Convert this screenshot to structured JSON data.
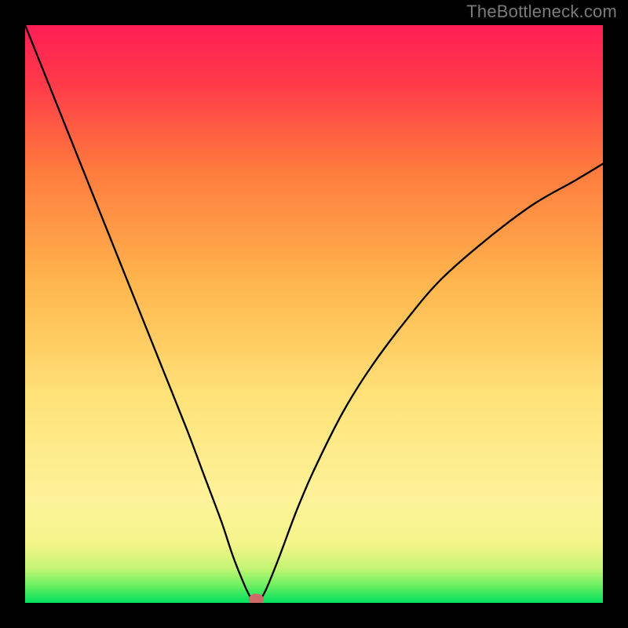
{
  "watermark": "TheBottleneck.com",
  "chart_data": {
    "type": "line",
    "title": "",
    "xlabel": "",
    "ylabel": "",
    "xlim": [
      0,
      100
    ],
    "ylim": [
      0,
      100
    ],
    "gradient_stops": [
      {
        "offset": 0.0,
        "color": "#00e05e"
      },
      {
        "offset": 0.03,
        "color": "#6bf060"
      },
      {
        "offset": 0.06,
        "color": "#c4f574"
      },
      {
        "offset": 0.1,
        "color": "#f3f58a"
      },
      {
        "offset": 0.18,
        "color": "#fef29a"
      },
      {
        "offset": 0.35,
        "color": "#ffe37a"
      },
      {
        "offset": 0.55,
        "color": "#ffb74e"
      },
      {
        "offset": 0.75,
        "color": "#ff7a3e"
      },
      {
        "offset": 0.9,
        "color": "#ff3a4a"
      },
      {
        "offset": 1.0,
        "color": "#ff1e56"
      }
    ],
    "curve": {
      "minimum_x": 40,
      "left_branch": [
        {
          "x": 0,
          "y": 100
        },
        {
          "x": 4,
          "y": 90
        },
        {
          "x": 8,
          "y": 80
        },
        {
          "x": 12,
          "y": 70
        },
        {
          "x": 16,
          "y": 60
        },
        {
          "x": 20,
          "y": 50
        },
        {
          "x": 24,
          "y": 40
        },
        {
          "x": 28,
          "y": 30
        },
        {
          "x": 31,
          "y": 22
        },
        {
          "x": 34,
          "y": 14
        },
        {
          "x": 36,
          "y": 8
        },
        {
          "x": 38,
          "y": 3
        },
        {
          "x": 39,
          "y": 1
        },
        {
          "x": 40,
          "y": 0
        }
      ],
      "right_branch": [
        {
          "x": 40,
          "y": 0
        },
        {
          "x": 41,
          "y": 1
        },
        {
          "x": 42,
          "y": 3
        },
        {
          "x": 44,
          "y": 8
        },
        {
          "x": 47,
          "y": 16
        },
        {
          "x": 50,
          "y": 23
        },
        {
          "x": 55,
          "y": 33
        },
        {
          "x": 60,
          "y": 41
        },
        {
          "x": 66,
          "y": 49
        },
        {
          "x": 72,
          "y": 56
        },
        {
          "x": 80,
          "y": 63
        },
        {
          "x": 88,
          "y": 69
        },
        {
          "x": 95,
          "y": 73
        },
        {
          "x": 100,
          "y": 76
        }
      ]
    },
    "marker": {
      "x": 40,
      "y": 0.6,
      "rx": 1.3,
      "ry": 1.0,
      "color": "#cf6a6a"
    }
  }
}
